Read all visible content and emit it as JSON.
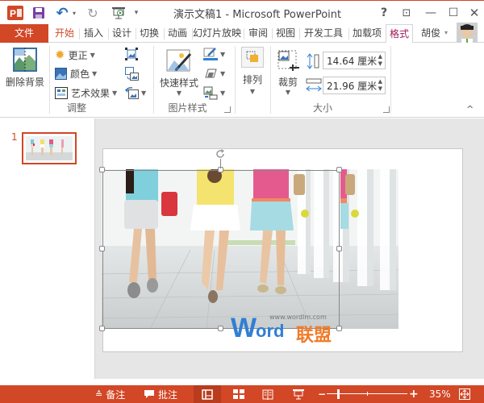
{
  "window": {
    "title": "演示文稿1 - Microsoft PowerPoint",
    "help": "?",
    "ribbon_display": "⊡",
    "minimize": "—",
    "maximize": "☐",
    "close": "✕"
  },
  "quick_access": {
    "app_icon": "P3",
    "save": "save-icon",
    "undo": "↶",
    "undo_caret": "▾",
    "redo": "↻",
    "start_slideshow": "slideshow-icon",
    "customize": "▾"
  },
  "tabs": [
    {
      "label": "文件"
    },
    {
      "label": "开始"
    },
    {
      "label": "插入"
    },
    {
      "label": "设计"
    },
    {
      "label": "切换"
    },
    {
      "label": "动画"
    },
    {
      "label": "幻灯片放映"
    },
    {
      "label": "审阅"
    },
    {
      "label": "视图"
    },
    {
      "label": "开发工具"
    },
    {
      "label": "加载项"
    },
    {
      "label": "格式"
    }
  ],
  "user": {
    "name": "胡俊",
    "caret": "▾"
  },
  "ribbon": {
    "adjust_group": {
      "label": "调整",
      "remove_background": "删除背景",
      "corrections": "更正",
      "color": "颜色",
      "artistic_effects": "艺术效果"
    },
    "picture_styles_group": {
      "label": "图片样式",
      "quick_styles": "快速样式"
    },
    "arrange_group": {
      "arrange": "排列"
    },
    "size_group": {
      "label": "大小",
      "crop": "裁剪",
      "height_value": "14.64 厘米",
      "width_value": "21.96 厘米"
    },
    "collapse": "^"
  },
  "slides_pane": {
    "slide_number": "1"
  },
  "watermark": {
    "url": "www.wordlm.com",
    "w": "W",
    "ord": "ord",
    "cn": "联盟"
  },
  "status_bar": {
    "notes": "备注",
    "comments": "批注",
    "zoom_level": "35%",
    "zoom_minus": "−",
    "zoom_plus": "+",
    "zoom_percent": 35
  },
  "colors": {
    "accent": "#d24726",
    "format_tab": "#a3195b"
  }
}
